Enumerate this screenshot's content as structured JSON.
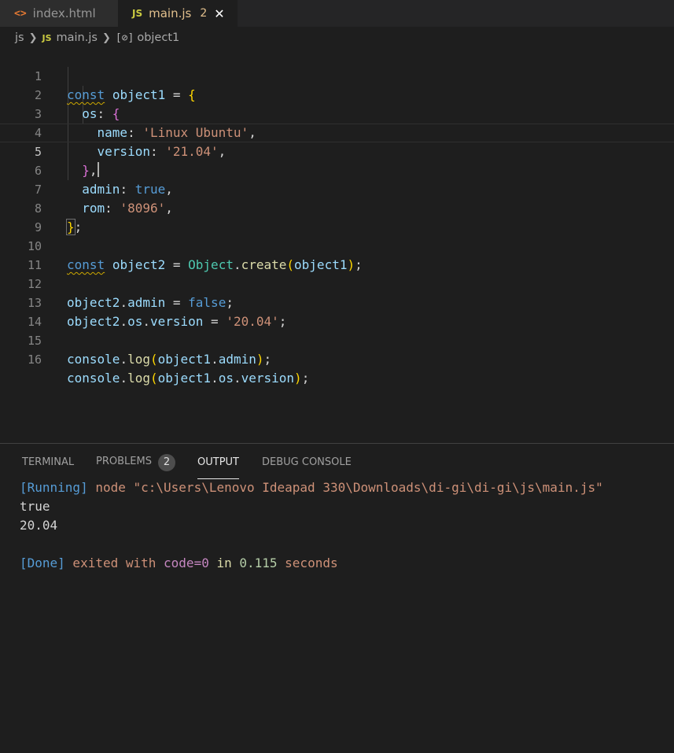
{
  "tabs": [
    {
      "label": "index.html",
      "icon": "html-icon",
      "icon_glyph": "<>"
    },
    {
      "label": "main.js",
      "icon": "js-icon",
      "icon_glyph": "JS",
      "problem_count": "2",
      "close_glyph": "✕"
    }
  ],
  "breadcrumb": {
    "folder": "js",
    "file_badge": "JS",
    "file": "main.js",
    "symbol_glyph": "[⊘]",
    "symbol": "object1"
  },
  "editor": {
    "line_numbers": [
      "1",
      "2",
      "3",
      "4",
      "5",
      "6",
      "7",
      "8",
      "9",
      "10",
      "11",
      "12",
      "13",
      "14",
      "15",
      "16"
    ],
    "current_line": 5,
    "code": {
      "l1": {
        "kw": "const",
        "var": "object1",
        "op": " = ",
        "brace": "{"
      },
      "l2": {
        "key": "os",
        "colon": ": ",
        "brace": "{"
      },
      "l3": {
        "key": "name",
        "colon": ": ",
        "str": "'Linux Ubuntu'",
        "comma": ","
      },
      "l4": {
        "key": "version",
        "colon": ": ",
        "str": "'21.04'",
        "comma": ","
      },
      "l5": {
        "brace": "}",
        "comma": ","
      },
      "l6": {
        "key": "admin",
        "colon": ": ",
        "bool": "true",
        "comma": ","
      },
      "l7": {
        "key": "rom",
        "colon": ": ",
        "str": "'8096'",
        "comma": ","
      },
      "l8": {
        "brace": "}",
        "semi": ";"
      },
      "l10": {
        "kw": "const",
        "var": "object2",
        "op": " = ",
        "cls": "Object",
        "dot": ".",
        "fn": "create",
        "paren_open": "(",
        "arg": "object1",
        "paren_close": ")",
        "semi": ";"
      },
      "l12": {
        "var": "object2",
        "dot": ".",
        "prop": "admin",
        "op": " = ",
        "bool": "false",
        "semi": ";"
      },
      "l13": {
        "var": "object2",
        "dot": ".",
        "prop": "os",
        "dot2": ".",
        "prop2": "version",
        "op": " = ",
        "str": "'20.04'",
        "semi": ";"
      },
      "l15": {
        "obj": "console",
        "dot": ".",
        "fn": "log",
        "paren_open": "(",
        "arg": "object1",
        "dot2": ".",
        "prop": "admin",
        "paren_close": ")",
        "semi": ";"
      },
      "l16": {
        "obj": "console",
        "dot": ".",
        "fn": "log",
        "paren_open": "(",
        "arg": "object1",
        "dot2": ".",
        "prop": "os",
        "dot3": ".",
        "prop2": "version",
        "paren_close": ")",
        "semi": ";"
      }
    }
  },
  "panel": {
    "tabs": [
      {
        "label": "TERMINAL"
      },
      {
        "label": "PROBLEMS",
        "badge": "2"
      },
      {
        "label": "OUTPUT",
        "active": true
      },
      {
        "label": "DEBUG CONSOLE"
      }
    ],
    "output": {
      "running_tag": "[Running]",
      "running_cmd": " node \"c:\\Users\\Lenovo Ideapad 330\\Downloads\\di-gi\\di-gi\\js\\main.js\"",
      "line1": "true",
      "line2": "20.04",
      "done_tag": "[Done]",
      "done_text1": " exited with ",
      "done_code": "code=0",
      "done_in": " in ",
      "done_time": "0.115",
      "done_seconds": " seconds"
    }
  },
  "colors": {
    "editor_bg": "#1e1e1e",
    "keyword": "#569cd6",
    "variable": "#9cdcfe",
    "string": "#ce9178",
    "class": "#4ec9b0",
    "function": "#dcdcaa",
    "bracket": "#ffd700"
  }
}
